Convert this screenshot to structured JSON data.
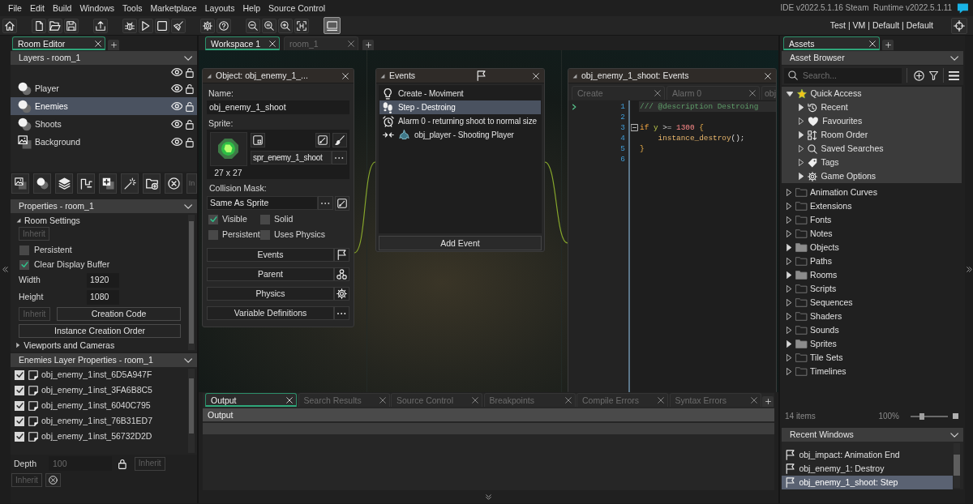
{
  "menu_bar": {
    "items": [
      "File",
      "Edit",
      "Build",
      "Windows",
      "Tools",
      "Marketplace",
      "Layouts",
      "Help",
      "Source Control"
    ],
    "version": "IDE v2022.5.1.16 Steam  Runtime v2022.5.1.11"
  },
  "toolbar": {
    "groups": [
      [
        {
          "kind": "home",
          "selected": false
        }
      ],
      [
        {
          "kind": "new",
          "selected": false
        },
        {
          "kind": "open",
          "selected": false
        },
        {
          "kind": "save",
          "selected": false
        }
      ],
      [
        {
          "kind": "export",
          "selected": false
        }
      ],
      [
        {
          "kind": "debug",
          "selected": false
        },
        {
          "kind": "run",
          "selected": false
        },
        {
          "kind": "stop",
          "selected": false
        },
        {
          "kind": "clean",
          "selected": false
        }
      ],
      [
        {
          "kind": "settings",
          "selected": false
        },
        {
          "kind": "help",
          "selected": false
        }
      ],
      [
        {
          "kind": "zoom_out",
          "selected": false
        },
        {
          "kind": "zoom_reset",
          "selected": false
        },
        {
          "kind": "zoom_in",
          "selected": false
        },
        {
          "kind": "fit",
          "selected": false
        }
      ],
      [
        {
          "kind": "device",
          "selected": true
        }
      ]
    ],
    "target": "Test | VM | Default | Default"
  },
  "room_editor": {
    "tabs": [
      {
        "label": "Room Editor",
        "selected": true
      }
    ],
    "layers": {
      "title": "Layers - room_1",
      "items": [
        {
          "label": "Player",
          "kind": "instances",
          "selected": false,
          "visible": true,
          "locked": false
        },
        {
          "label": "Enemies",
          "kind": "instances",
          "selected": true,
          "visible": true,
          "locked": false
        },
        {
          "label": "Shoots",
          "kind": "instances",
          "selected": false,
          "visible": true,
          "locked": false
        },
        {
          "label": "Background",
          "kind": "background",
          "selected": false,
          "visible": true,
          "locked": false
        }
      ]
    },
    "tool_strip_button": "In",
    "properties": {
      "title": "Properties - room_1",
      "section": {
        "label": "Room Settings",
        "expanded": true
      },
      "inherit": {
        "label": "Inherit",
        "disabled": true
      },
      "checkboxes": [
        {
          "label": "Persistent",
          "checked": false
        },
        {
          "label": "Clear Display Buffer",
          "checked": true
        }
      ],
      "fields": [
        {
          "label": "Width",
          "value": "1920"
        },
        {
          "label": "Height",
          "value": "1080"
        }
      ],
      "code_inherit": {
        "label": "Inherit",
        "disabled": true
      },
      "creation_code": "Creation Code",
      "creation_order": "Instance Creation Order",
      "next_section": {
        "label": "Viewports and Cameras",
        "expanded": false
      }
    },
    "layer_properties": {
      "title": "Enemies Layer Properties - room_1",
      "instances": [
        {
          "object": "obj_enemy_1",
          "name": "inst_6D5A947F",
          "checked": true
        },
        {
          "object": "obj_enemy_1",
          "name": "inst_3FA6B8C5",
          "checked": true
        },
        {
          "object": "obj_enemy_1",
          "name": "inst_6040C795",
          "checked": true
        },
        {
          "object": "obj_enemy_1",
          "name": "inst_76B31ED7",
          "checked": true
        },
        {
          "object": "obj_enemy_1",
          "name": "inst_56732D2D",
          "checked": true
        }
      ],
      "depth": {
        "label": "Depth",
        "value": "100",
        "disabled": true
      },
      "depth_inherit": {
        "label": "Inherit",
        "disabled": true
      },
      "inherit": {
        "label": "Inherit",
        "disabled": true
      }
    }
  },
  "workspace": {
    "tabs": [
      {
        "label": "Workspace 1",
        "selected": true
      },
      {
        "label": "room_1",
        "selected": false
      }
    ],
    "object_window": {
      "title": "Object: obj_enemy_1_...",
      "name_label": "Name:",
      "name": "obj_enemy_1_shoot",
      "sprite_label": "Sprite:",
      "sprite": "spr_enemy_1_shoot",
      "sprite_size": "27 x 27",
      "collision_label": "Collision Mask:",
      "collision_mask": "Same As Sprite",
      "checkboxes": [
        {
          "label": "Visible",
          "checked": true
        },
        {
          "label": "Solid",
          "checked": false
        },
        {
          "label": "Persistent",
          "checked": false
        },
        {
          "label": "Uses Physics",
          "checked": false
        }
      ],
      "buttons": [
        {
          "label": "Events",
          "kind": "events"
        },
        {
          "label": "Parent",
          "kind": "parent"
        },
        {
          "label": "Physics",
          "kind": "physics"
        },
        {
          "label": "Variable Definitions",
          "kind": "variables"
        }
      ]
    },
    "events_window": {
      "title": "Events",
      "events": [
        {
          "kind": "create",
          "label": "Create - Moviment",
          "selected": false
        },
        {
          "kind": "step",
          "label": "Step - Destroing",
          "selected": true
        },
        {
          "kind": "alarm",
          "label": "Alarm 0 - returning shoot to normal size",
          "selected": false
        },
        {
          "kind": "collision",
          "label": "obj_player - Shooting Player",
          "selected": false
        }
      ],
      "add_button": "Add Event"
    },
    "code_editor": {
      "title": "obj_enemy_1_shoot: Events",
      "tabs": [
        {
          "label": "Create",
          "selected": false
        },
        {
          "label": "Alarm 0",
          "selected": false
        },
        {
          "label": "obj",
          "selected": false
        }
      ],
      "lines": [
        {
          "number": "1",
          "highlighted": true,
          "marker": true,
          "fold": false,
          "tokens": [
            {
              "kind": "comment",
              "text": "/// @description Destroing"
            }
          ]
        },
        {
          "number": "2",
          "highlighted": false,
          "marker": false,
          "fold": false
        },
        {
          "number": "3",
          "highlighted": false,
          "marker": false,
          "fold": true,
          "tokens": [
            {
              "kind": "keyword",
              "text": "if"
            },
            {
              "kind": "variable",
              "text": " y"
            },
            {
              "kind": "operator",
              "text": " >= "
            },
            {
              "kind": "number",
              "text": "1300"
            },
            {
              "kind": "punctuation",
              "text": " {"
            }
          ]
        },
        {
          "number": "4",
          "highlighted": false,
          "marker": false,
          "fold": false,
          "tokens": [
            {
              "kind": "function",
              "text": "    instance_destroy"
            },
            {
              "kind": "plain",
              "text": "();"
            }
          ]
        },
        {
          "number": "5",
          "highlighted": false,
          "marker": false,
          "fold": false,
          "tokens": [
            {
              "kind": "punctuation",
              "text": "}"
            }
          ]
        },
        {
          "number": "6",
          "highlighted": false,
          "marker": false,
          "fold": false
        }
      ]
    }
  },
  "output_panel": {
    "tabs": [
      {
        "label": "Output",
        "selected": true
      },
      {
        "label": "Search Results",
        "selected": false
      },
      {
        "label": "Source Control",
        "selected": false
      },
      {
        "label": "Breakpoints",
        "selected": false
      },
      {
        "label": "Compile Errors",
        "selected": false
      },
      {
        "label": "Syntax Errors",
        "selected": false
      }
    ],
    "title": "Output"
  },
  "assets": {
    "tabs": [
      {
        "label": "Assets",
        "selected": true
      }
    ],
    "title": "Asset Browser",
    "search": {
      "placeholder": "Search..."
    },
    "tree": [
      {
        "label": "Quick Access",
        "kind": "quick_access",
        "expanded": true,
        "children": [
          {
            "label": "Recent",
            "kind": "recent",
            "empty": false
          },
          {
            "label": "Favourites",
            "kind": "favourites",
            "empty": true
          },
          {
            "label": "Room Order",
            "kind": "room_order",
            "empty": false
          },
          {
            "label": "Saved Searches",
            "kind": "saved_searches",
            "empty": true
          },
          {
            "label": "Tags",
            "kind": "tags",
            "empty": true
          },
          {
            "label": "Game Options",
            "kind": "game_options",
            "empty": false
          }
        ]
      },
      {
        "label": "Animation Curves",
        "kind": "folder",
        "empty": true
      },
      {
        "label": "Extensions",
        "kind": "folder",
        "empty": true
      },
      {
        "label": "Fonts",
        "kind": "folder",
        "empty": true
      },
      {
        "label": "Notes",
        "kind": "folder",
        "empty": true
      },
      {
        "label": "Objects",
        "kind": "folder",
        "empty": false
      },
      {
        "label": "Paths",
        "kind": "folder",
        "empty": true
      },
      {
        "label": "Rooms",
        "kind": "folder",
        "empty": false
      },
      {
        "label": "Scripts",
        "kind": "folder",
        "empty": true
      },
      {
        "label": "Sequences",
        "kind": "folder",
        "empty": true
      },
      {
        "label": "Shaders",
        "kind": "folder",
        "empty": true
      },
      {
        "label": "Sounds",
        "kind": "folder",
        "empty": true
      },
      {
        "label": "Sprites",
        "kind": "folder",
        "empty": false
      },
      {
        "label": "Tile Sets",
        "kind": "folder",
        "empty": true
      },
      {
        "label": "Timelines",
        "kind": "folder",
        "empty": true
      }
    ],
    "count": "14 items",
    "zoom": {
      "reading": "100%",
      "level": 0.3
    },
    "recent_windows": {
      "title": "Recent Windows",
      "items": [
        {
          "label": "obj_impact: Animation End",
          "selected": false
        },
        {
          "label": "obj_enemy_1: Destroy",
          "selected": false
        },
        {
          "label": "obj_enemy_1_shoot: Step",
          "selected": true
        }
      ]
    }
  }
}
